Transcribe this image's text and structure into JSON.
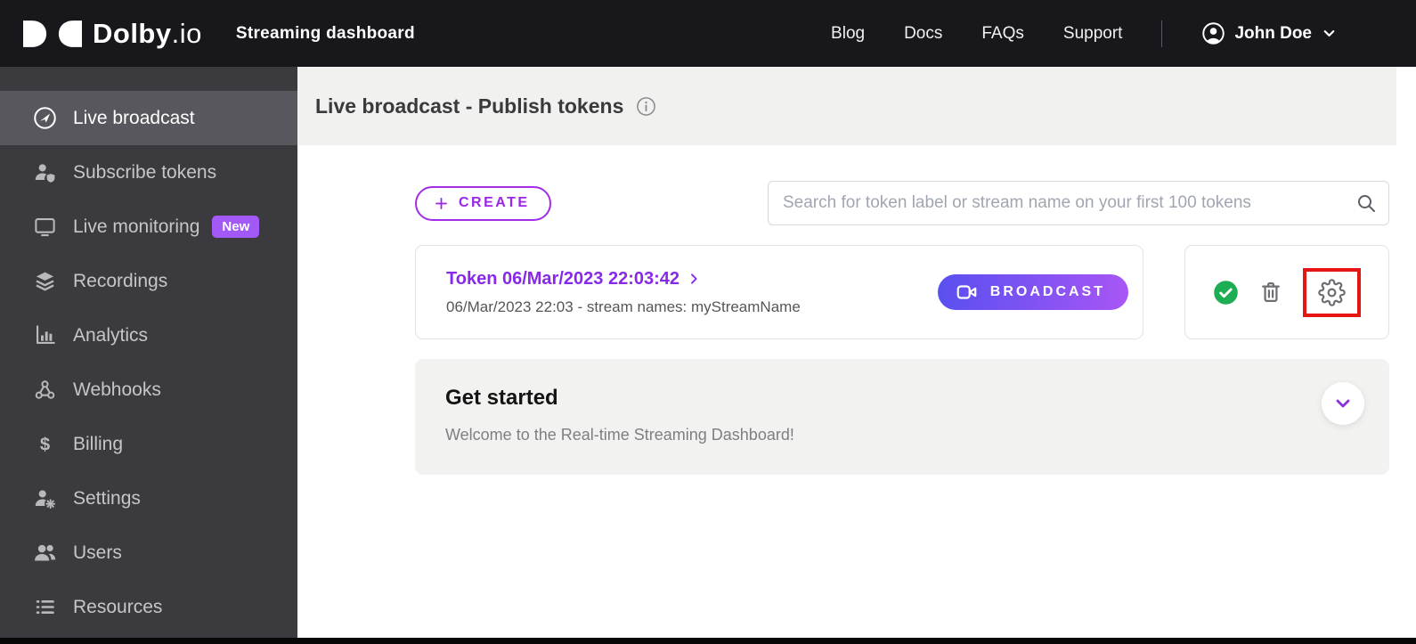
{
  "topbar": {
    "logo": {
      "brand": "Dolby",
      "suffix": ".io"
    },
    "app_title": "Streaming dashboard",
    "nav": [
      {
        "label": "Blog"
      },
      {
        "label": "Docs"
      },
      {
        "label": "FAQs"
      },
      {
        "label": "Support"
      }
    ],
    "user": {
      "name": "John Doe"
    }
  },
  "sidebar": {
    "items": [
      {
        "label": "Live broadcast",
        "icon": "live-broadcast-icon",
        "active": true
      },
      {
        "label": "Subscribe tokens",
        "icon": "subscribe-tokens-icon"
      },
      {
        "label": "Live monitoring",
        "icon": "monitor-icon",
        "badge": "New"
      },
      {
        "label": "Recordings",
        "icon": "layers-icon"
      },
      {
        "label": "Analytics",
        "icon": "bar-chart-icon"
      },
      {
        "label": "Webhooks",
        "icon": "webhook-icon"
      },
      {
        "label": "Billing",
        "icon": "dollar-icon"
      },
      {
        "label": "Settings",
        "icon": "person-gear-icon"
      },
      {
        "label": "Users",
        "icon": "users-icon"
      },
      {
        "label": "Resources",
        "icon": "list-icon"
      }
    ]
  },
  "page": {
    "title": "Live broadcast - Publish tokens"
  },
  "toolbar": {
    "create_label": "CREATE",
    "search_placeholder": "Search for token label or stream name on your first 100 tokens"
  },
  "token_row": {
    "title": "Token 06/Mar/2023 22:03:42",
    "subtitle": "06/Mar/2023 22:03 - stream names: myStreamName",
    "broadcast_label": "BROADCAST"
  },
  "get_started": {
    "title": "Get started",
    "subtitle": "Welcome to the Real-time Streaming Dashboard!"
  },
  "colors": {
    "accent_purple": "#9a25eb",
    "badge_purple": "#a259f7",
    "broadcast_gradient_start": "#5a4ff0",
    "broadcast_gradient_end": "#a856f5",
    "status_green": "#1dad52",
    "highlight_red": "#e81515",
    "topbar_bg": "#18181c",
    "sidebar_bg": "#3b3b3f",
    "sidebar_active_bg": "#57575d",
    "header_band_bg": "#f1f1ef"
  }
}
